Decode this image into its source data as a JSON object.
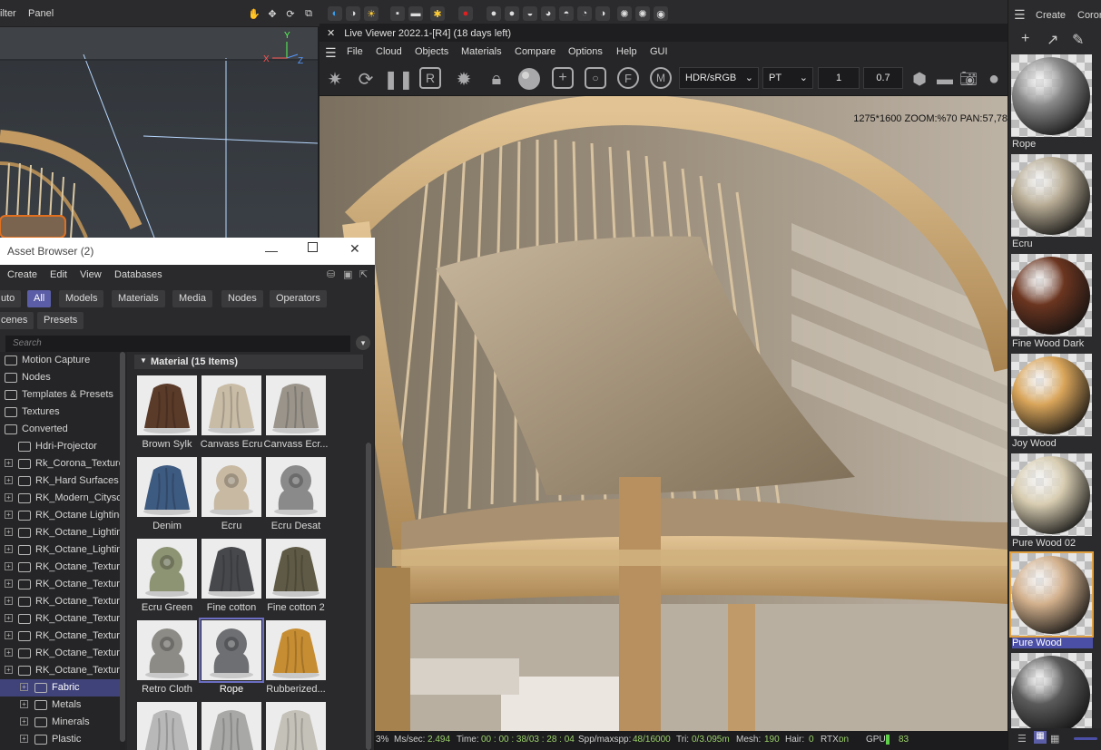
{
  "top_bar": {
    "menu_left": [
      "ilter",
      "Panel"
    ],
    "mat_panel_menu": "Create",
    "mat_panel_menu_cut": "Coron"
  },
  "live_viewer": {
    "title": "Live Viewer 2022.1-[R4] (18 days left)",
    "menu": [
      "File",
      "Cloud",
      "Objects",
      "Materials",
      "Compare",
      "Options",
      "Help",
      "GUI"
    ],
    "color_space": "HDR/sRGB",
    "kernel": "PT",
    "value_1": "1",
    "value_2": "0.7",
    "info_overlay": "1275*1600 ZOOM:%70  PAN:57,78",
    "status": {
      "percent": "3%",
      "ms_label": "Ms/sec:",
      "ms_value": "2.494",
      "time_label": "Time:",
      "time_value": "00 : 00 : 38/03 : 28 : 04",
      "spp_label": "Spp/maxspp:",
      "spp_value": "48/16000",
      "tri_label": "Tri:",
      "tri_value": "0/3.095m",
      "mesh_label": "Mesh:",
      "mesh_value": "190",
      "hair_label": "Hair:",
      "hair_value": "0",
      "rtx_label": "RTX:",
      "rtx_value": "on",
      "gpu_label": "GPU:",
      "gpu_value": "83"
    }
  },
  "asset_browser": {
    "title": "Asset Browser (2)",
    "menu": [
      "Create",
      "Edit",
      "View",
      "Databases"
    ],
    "filters_row1": [
      "uto",
      "All",
      "Models",
      "Materials",
      "Media",
      "Nodes",
      "Operators"
    ],
    "filters_row2": [
      "cenes",
      "Presets"
    ],
    "active_filter": "All",
    "search_placeholder": "Search",
    "tree": [
      {
        "label": "Motion Capture",
        "indent": 0,
        "expander": false
      },
      {
        "label": "Nodes",
        "indent": 0,
        "expander": false
      },
      {
        "label": "Templates & Presets",
        "indent": 0,
        "expander": false
      },
      {
        "label": "Textures",
        "indent": 0,
        "expander": false
      },
      {
        "label": "Converted",
        "indent": 0,
        "expander": false
      },
      {
        "label": "Hdri-Projector",
        "indent": 1,
        "expander": false
      },
      {
        "label": "Rk_Corona_Textures",
        "indent": 1,
        "expander": true
      },
      {
        "label": "RK_Hard Surfaces v",
        "indent": 1,
        "expander": true
      },
      {
        "label": "RK_Modern_Cityscape",
        "indent": 1,
        "expander": true
      },
      {
        "label": "RK_Octane Lighting",
        "indent": 1,
        "expander": true
      },
      {
        "label": "RK_Octane_Lighting",
        "indent": 1,
        "expander": true
      },
      {
        "label": "RK_Octane_Lighting",
        "indent": 1,
        "expander": true
      },
      {
        "label": "RK_Octane_Textures",
        "indent": 1,
        "expander": true
      },
      {
        "label": "RK_Octane_Textures",
        "indent": 1,
        "expander": true
      },
      {
        "label": "RK_Octane_Textures",
        "indent": 1,
        "expander": true
      },
      {
        "label": "RK_Octane_Textures",
        "indent": 1,
        "expander": true
      },
      {
        "label": "RK_Octane_Textures",
        "indent": 1,
        "expander": true
      },
      {
        "label": "RK_Octane_Textures",
        "indent": 1,
        "expander": true
      },
      {
        "label": "RK_Octane_Textures",
        "indent": 1,
        "expander": true
      },
      {
        "label": "Fabric",
        "indent": 2,
        "expander": true,
        "selected": true
      },
      {
        "label": "Metals",
        "indent": 2,
        "expander": true
      },
      {
        "label": "Minerals",
        "indent": 2,
        "expander": true
      },
      {
        "label": "Plastic",
        "indent": 2,
        "expander": true
      }
    ],
    "section_header": "Material (15 Items)",
    "materials": [
      {
        "name": "Brown Sylk",
        "kind": "cloth",
        "color": "#5a3a28"
      },
      {
        "name": "Canvass Ecru",
        "kind": "cloth",
        "color": "#c9bca6"
      },
      {
        "name": "Canvass Ecr...",
        "kind": "cloth",
        "color": "#9a948b"
      },
      {
        "name": "Denim",
        "kind": "cloth",
        "color": "#3d5a80"
      },
      {
        "name": "Ecru",
        "kind": "knob",
        "color": "#c8b9a3"
      },
      {
        "name": "Ecru Desat",
        "kind": "knob",
        "color": "#8a8a8a"
      },
      {
        "name": "Ecru Green",
        "kind": "knob",
        "color": "#8d9474"
      },
      {
        "name": "Fine cotton",
        "kind": "cloth",
        "color": "#46484c"
      },
      {
        "name": "Fine cotton 2",
        "kind": "cloth",
        "color": "#5f5a45"
      },
      {
        "name": "Retro Cloth",
        "kind": "knob",
        "color": "#8d8b86"
      },
      {
        "name": "Rope",
        "kind": "knob",
        "color": "#6e6f72",
        "selected": true
      },
      {
        "name": "Rubberized...",
        "kind": "cloth",
        "color": "#c78d32"
      },
      {
        "name": "",
        "kind": "cloth",
        "color": "#b8b8b8"
      },
      {
        "name": "",
        "kind": "cloth",
        "color": "#a8a8a6"
      },
      {
        "name": "",
        "kind": "cloth",
        "color": "#c4c1b8"
      }
    ]
  },
  "material_panel": {
    "items": [
      {
        "name": "Rope",
        "color": "#8a8a8a"
      },
      {
        "name": "Ecru",
        "color": "#b8ac95"
      },
      {
        "name": "Fine Wood Dark",
        "color": "#6b3520"
      },
      {
        "name": "Joy Wood",
        "color": "#d9a55a"
      },
      {
        "name": "Pure Wood 02",
        "color": "#d8cdb2"
      },
      {
        "name": "Pure Wood",
        "color": "#d2b08c",
        "selected": true
      },
      {
        "name": "",
        "color": "#5b5b5b"
      }
    ]
  }
}
